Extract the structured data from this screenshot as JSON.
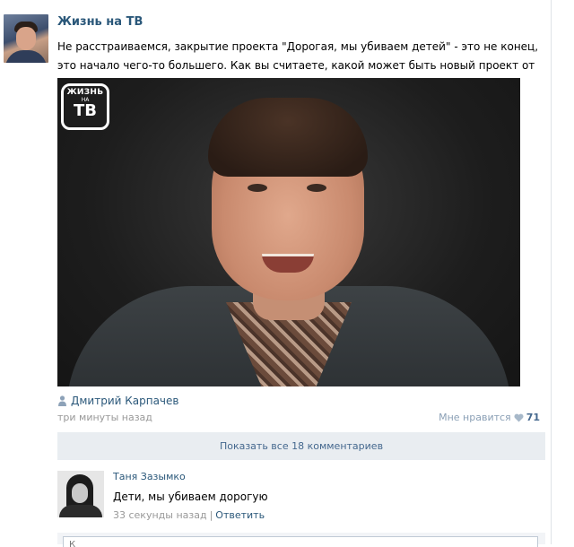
{
  "post": {
    "author": "Жизнь на ТВ",
    "text": "Не расстраиваемся, закрытие проекта \"Дорогая, мы убиваем детей\" - это не конец, это начало чего-то большего. Как вы считаете, какой может быть новый проект от СТБ?",
    "photo_logo": {
      "line1": "ЖИЗНЬ",
      "line2": "НА",
      "line3": "ТВ"
    },
    "photo_author": "Дмитрий Карпачев",
    "time": "три минуты назад",
    "like_label": "Мне нравится",
    "like_count": "71"
  },
  "comments_bar": {
    "label": "Показать все 18 комментариев"
  },
  "comment": {
    "name": "Таня Зазымко",
    "text": "Дети, мы убиваем дорогую",
    "time": "33 секунды назад",
    "separator": "|",
    "reply_label": "Ответить"
  },
  "reply_box": {
    "placeholder": "К"
  },
  "colors": {
    "link": "#2b587a",
    "muted": "#999999",
    "bar": "#e9edf1"
  }
}
